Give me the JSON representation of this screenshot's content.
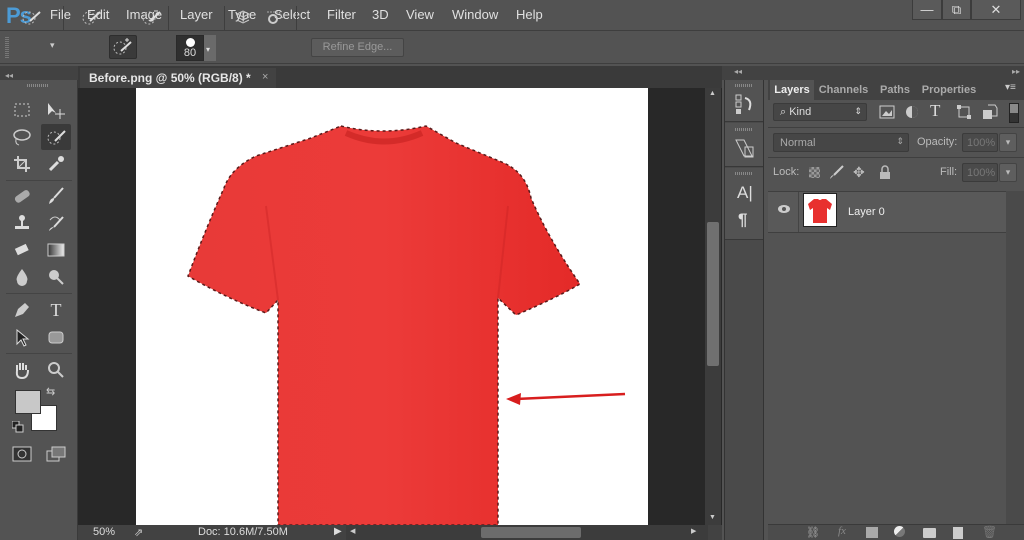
{
  "app": {
    "logo": "Ps"
  },
  "menu": [
    "File",
    "Edit",
    "Image",
    "Layer",
    "Type",
    "Select",
    "Filter",
    "3D",
    "View",
    "Window",
    "Help"
  ],
  "window_controls": {
    "minimize": "—",
    "restore": "⧉",
    "close": "✕"
  },
  "options_bar": {
    "brush_size": "80",
    "refine_edge_label": "Refine Edge..."
  },
  "document": {
    "tab_title": "Before.png @ 50% (RGB/8) *",
    "tab_close": "×",
    "zoom": "50%",
    "doc_info": "Doc: 10.6M/7.50M",
    "shirt_color": "#e8302f",
    "arrow_color": "#d81e1e"
  },
  "colors": {
    "foreground": "#c8c8c8",
    "background": "#ffffff"
  },
  "layers_panel": {
    "tabs": [
      "Layers",
      "Channels",
      "Paths",
      "Properties"
    ],
    "active_tab": "Layers",
    "filter_kind": "Kind",
    "blend_mode": "Normal",
    "opacity_label": "Opacity:",
    "opacity_value": "100%",
    "lock_label": "Lock:",
    "fill_label": "Fill:",
    "fill_value": "100%",
    "layers": [
      {
        "name": "Layer 0",
        "visible": true
      }
    ]
  }
}
